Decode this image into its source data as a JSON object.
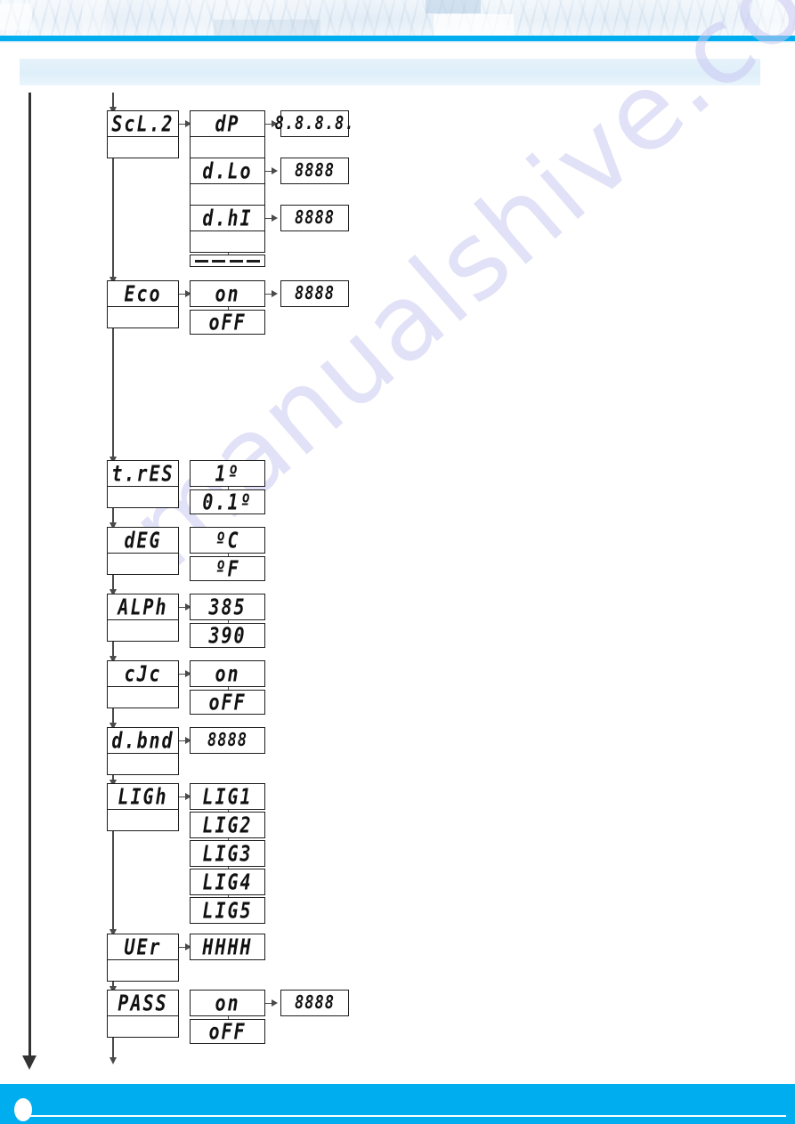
{
  "page": {
    "title_band_text": "",
    "watermark": "manualshive.com",
    "accent_color": "#00aeef",
    "line_color": "#333333",
    "lcd_border_color": "#1d1d1d",
    "watermark_color": "#c9c9f2"
  },
  "diagram": {
    "type": "menu-flowchart",
    "spine_label": "main-menu-spine",
    "nodes": [
      {
        "id": "scl2",
        "menu": "ScL.2",
        "options": [
          {
            "label": "dP",
            "value": "8.8.8.8."
          },
          {
            "label": "d.Lo",
            "value": "8888"
          },
          {
            "label": "d.hI",
            "value": "8888"
          },
          {
            "label": "- - - -",
            "value": null
          }
        ]
      },
      {
        "id": "eco",
        "menu": "Eco",
        "options": [
          {
            "label": "on",
            "value": "8888"
          },
          {
            "label": "oFF",
            "value": null
          }
        ]
      },
      {
        "id": "tres",
        "menu": "t.rES",
        "options": [
          {
            "label": "1º",
            "value": null
          },
          {
            "label": "0.1º",
            "value": null
          }
        ]
      },
      {
        "id": "deg",
        "menu": "dEG",
        "options": [
          {
            "label": "ºC",
            "value": null
          },
          {
            "label": "ºF",
            "value": null
          }
        ]
      },
      {
        "id": "alph",
        "menu": "ALPh",
        "options": [
          {
            "label": "385",
            "value": null
          },
          {
            "label": "390",
            "value": null
          }
        ]
      },
      {
        "id": "cjc",
        "menu": "cJc",
        "options": [
          {
            "label": "on",
            "value": null
          },
          {
            "label": "oFF",
            "value": null
          }
        ]
      },
      {
        "id": "dbnd",
        "menu": "d.bnd",
        "options": [
          {
            "label": "8888",
            "value": null
          }
        ]
      },
      {
        "id": "ligh",
        "menu": "LIGh",
        "options": [
          {
            "label": "LIG1",
            "value": null
          },
          {
            "label": "LIG2",
            "value": null
          },
          {
            "label": "LIG3",
            "value": null
          },
          {
            "label": "LIG4",
            "value": null
          },
          {
            "label": "LIG5",
            "value": null
          }
        ]
      },
      {
        "id": "uer",
        "menu": "UEr",
        "options": [
          {
            "label": "HHHH",
            "value": null
          }
        ]
      },
      {
        "id": "pass",
        "menu": "PASS",
        "options": [
          {
            "label": "on",
            "value": "8888"
          },
          {
            "label": "oFF",
            "value": null
          }
        ]
      }
    ]
  }
}
